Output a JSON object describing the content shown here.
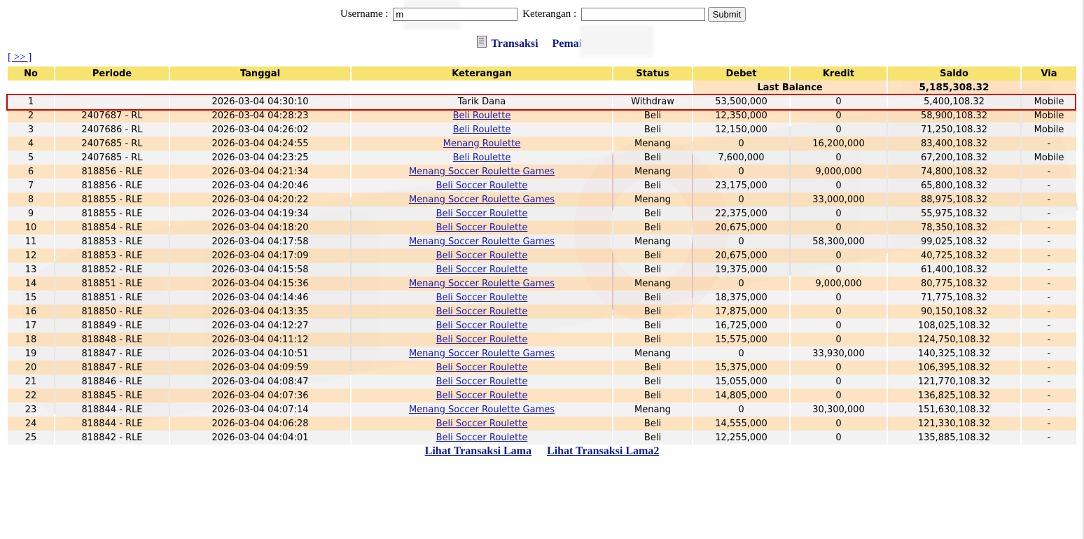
{
  "search": {
    "username_label": "Username :",
    "username_value": "m",
    "keterangan_label": "Keterangan :",
    "keterangan_value": "",
    "submit_label": "Submit"
  },
  "heading": {
    "title": "Transaksi",
    "player_label": "Pemain : m"
  },
  "pager_label": "[ >> ]",
  "table": {
    "columns": [
      "No",
      "Periode",
      "Tanggal",
      "Keterangan",
      "Status",
      "Debet",
      "Kredit",
      "Saldo",
      "Via"
    ],
    "last_balance_label": "Last Balance",
    "last_balance_value": "5,185,308.32",
    "rows": [
      {
        "no": "1",
        "periode": "",
        "tanggal": "2026-03-04 04:30:10",
        "keterangan": "Tarik Dana",
        "status": "Withdraw",
        "debet": "53,500,000",
        "kredit": "0",
        "saldo": "5,400,108.32",
        "via": "Mobile"
      },
      {
        "no": "2",
        "periode": "2407687 - RL",
        "tanggal": "2026-03-04 04:28:23",
        "keterangan": "Beli Roulette",
        "status": "Beli",
        "debet": "12,350,000",
        "kredit": "0",
        "saldo": "58,900,108.32",
        "via": "Mobile"
      },
      {
        "no": "3",
        "periode": "2407686 - RL",
        "tanggal": "2026-03-04 04:26:02",
        "keterangan": "Beli Roulette",
        "status": "Beli",
        "debet": "12,150,000",
        "kredit": "0",
        "saldo": "71,250,108.32",
        "via": "Mobile"
      },
      {
        "no": "4",
        "periode": "2407685 - RL",
        "tanggal": "2026-03-04 04:24:55",
        "keterangan": "Menang Roulette",
        "status": "Menang",
        "debet": "0",
        "kredit": "16,200,000",
        "saldo": "83,400,108.32",
        "via": "-"
      },
      {
        "no": "5",
        "periode": "2407685 - RL",
        "tanggal": "2026-03-04 04:23:25",
        "keterangan": "Beli Roulette",
        "status": "Beli",
        "debet": "7,600,000",
        "kredit": "0",
        "saldo": "67,200,108.32",
        "via": "Mobile"
      },
      {
        "no": "6",
        "periode": "818856 - RLE",
        "tanggal": "2026-03-04 04:21:34",
        "keterangan": "Menang Soccer Roulette Games",
        "status": "Menang",
        "debet": "0",
        "kredit": "9,000,000",
        "saldo": "74,800,108.32",
        "via": "-"
      },
      {
        "no": "7",
        "periode": "818856 - RLE",
        "tanggal": "2026-03-04 04:20:46",
        "keterangan": "Beli Soccer Roulette",
        "status": "Beli",
        "debet": "23,175,000",
        "kredit": "0",
        "saldo": "65,800,108.32",
        "via": "-"
      },
      {
        "no": "8",
        "periode": "818855 - RLE",
        "tanggal": "2026-03-04 04:20:22",
        "keterangan": "Menang Soccer Roulette Games",
        "status": "Menang",
        "debet": "0",
        "kredit": "33,000,000",
        "saldo": "88,975,108.32",
        "via": "-"
      },
      {
        "no": "9",
        "periode": "818855 - RLE",
        "tanggal": "2026-03-04 04:19:34",
        "keterangan": "Beli Soccer Roulette",
        "status": "Beli",
        "debet": "22,375,000",
        "kredit": "0",
        "saldo": "55,975,108.32",
        "via": "-"
      },
      {
        "no": "10",
        "periode": "818854 - RLE",
        "tanggal": "2026-03-04 04:18:20",
        "keterangan": "Beli Soccer Roulette",
        "status": "Beli",
        "debet": "20,675,000",
        "kredit": "0",
        "saldo": "78,350,108.32",
        "via": "-"
      },
      {
        "no": "11",
        "periode": "818853 - RLE",
        "tanggal": "2026-03-04 04:17:58",
        "keterangan": "Menang Soccer Roulette Games",
        "status": "Menang",
        "debet": "0",
        "kredit": "58,300,000",
        "saldo": "99,025,108.32",
        "via": "-"
      },
      {
        "no": "12",
        "periode": "818853 - RLE",
        "tanggal": "2026-03-04 04:17:09",
        "keterangan": "Beli Soccer Roulette",
        "status": "Beli",
        "debet": "20,675,000",
        "kredit": "0",
        "saldo": "40,725,108.32",
        "via": "-"
      },
      {
        "no": "13",
        "periode": "818852 - RLE",
        "tanggal": "2026-03-04 04:15:58",
        "keterangan": "Beli Soccer Roulette",
        "status": "Beli",
        "debet": "19,375,000",
        "kredit": "0",
        "saldo": "61,400,108.32",
        "via": "-"
      },
      {
        "no": "14",
        "periode": "818851 - RLE",
        "tanggal": "2026-03-04 04:15:36",
        "keterangan": "Menang Soccer Roulette Games",
        "status": "Menang",
        "debet": "0",
        "kredit": "9,000,000",
        "saldo": "80,775,108.32",
        "via": "-"
      },
      {
        "no": "15",
        "periode": "818851 - RLE",
        "tanggal": "2026-03-04 04:14:46",
        "keterangan": "Beli Soccer Roulette",
        "status": "Beli",
        "debet": "18,375,000",
        "kredit": "0",
        "saldo": "71,775,108.32",
        "via": "-"
      },
      {
        "no": "16",
        "periode": "818850 - RLE",
        "tanggal": "2026-03-04 04:13:35",
        "keterangan": "Beli Soccer Roulette",
        "status": "Beli",
        "debet": "17,875,000",
        "kredit": "0",
        "saldo": "90,150,108.32",
        "via": "-"
      },
      {
        "no": "17",
        "periode": "818849 - RLE",
        "tanggal": "2026-03-04 04:12:27",
        "keterangan": "Beli Soccer Roulette",
        "status": "Beli",
        "debet": "16,725,000",
        "kredit": "0",
        "saldo": "108,025,108.32",
        "via": "-"
      },
      {
        "no": "18",
        "periode": "818848 - RLE",
        "tanggal": "2026-03-04 04:11:12",
        "keterangan": "Beli Soccer Roulette",
        "status": "Beli",
        "debet": "15,575,000",
        "kredit": "0",
        "saldo": "124,750,108.32",
        "via": "-"
      },
      {
        "no": "19",
        "periode": "818847 - RLE",
        "tanggal": "2026-03-04 04:10:51",
        "keterangan": "Menang Soccer Roulette Games",
        "status": "Menang",
        "debet": "0",
        "kredit": "33,930,000",
        "saldo": "140,325,108.32",
        "via": "-"
      },
      {
        "no": "20",
        "periode": "818847 - RLE",
        "tanggal": "2026-03-04 04:09:59",
        "keterangan": "Beli Soccer Roulette",
        "status": "Beli",
        "debet": "15,375,000",
        "kredit": "0",
        "saldo": "106,395,108.32",
        "via": "-"
      },
      {
        "no": "21",
        "periode": "818846 - RLE",
        "tanggal": "2026-03-04 04:08:47",
        "keterangan": "Beli Soccer Roulette",
        "status": "Beli",
        "debet": "15,055,000",
        "kredit": "0",
        "saldo": "121,770,108.32",
        "via": "-"
      },
      {
        "no": "22",
        "periode": "818845 - RLE",
        "tanggal": "2026-03-04 04:07:36",
        "keterangan": "Beli Soccer Roulette",
        "status": "Beli",
        "debet": "14,805,000",
        "kredit": "0",
        "saldo": "136,825,108.32",
        "via": "-"
      },
      {
        "no": "23",
        "periode": "818844 - RLE",
        "tanggal": "2026-03-04 04:07:14",
        "keterangan": "Menang Soccer Roulette Games",
        "status": "Menang",
        "debet": "0",
        "kredit": "30,300,000",
        "saldo": "151,630,108.32",
        "via": "-"
      },
      {
        "no": "24",
        "periode": "818844 - RLE",
        "tanggal": "2026-03-04 04:06:28",
        "keterangan": "Beli Soccer Roulette",
        "status": "Beli",
        "debet": "14,555,000",
        "kredit": "0",
        "saldo": "121,330,108.32",
        "via": "-"
      },
      {
        "no": "25",
        "periode": "818842 - RLE",
        "tanggal": "2026-03-04 04:04:01",
        "keterangan": "Beli Soccer Roulette",
        "status": "Beli",
        "debet": "12,255,000",
        "kredit": "0",
        "saldo": "135,885,108.32",
        "via": "-"
      }
    ]
  },
  "footer": {
    "link1": "Lihat Transaksi Lama",
    "link2": "Lihat Transaksi Lama2"
  },
  "colors": {
    "header_bg": "#f6e370",
    "row_odd": "#f0f0f0",
    "row_even": "#fddfb8",
    "status_red": "#d01010",
    "value_blue": "#1a2fd0",
    "highlight_border": "#d00000"
  }
}
